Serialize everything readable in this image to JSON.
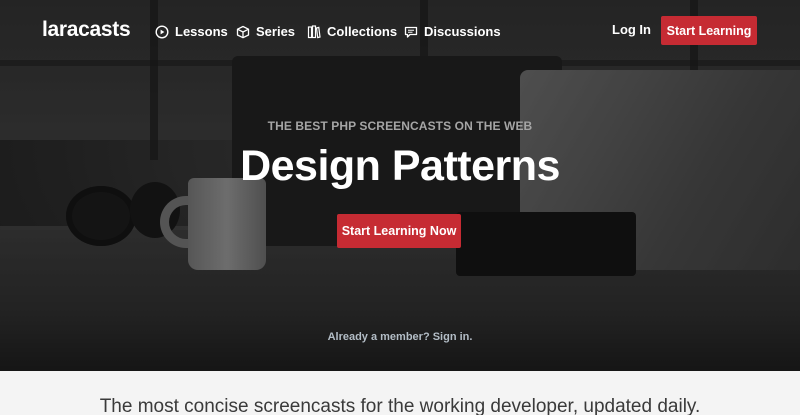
{
  "nav": {
    "logo": "laracasts",
    "items": [
      {
        "label": "Lessons",
        "icon": "play-circle-icon"
      },
      {
        "label": "Series",
        "icon": "cube-icon"
      },
      {
        "label": "Collections",
        "icon": "books-icon"
      },
      {
        "label": "Discussions",
        "icon": "chat-icon"
      }
    ],
    "login_label": "Log In",
    "cta_label": "Start Learning"
  },
  "hero": {
    "kicker": "THE BEST PHP SCREENCASTS ON THE WEB",
    "headline": "Design Patterns",
    "cta_label": "Start Learning Now",
    "member_text": "Already a member? Sign in."
  },
  "content": {
    "tagline": "The most concise screencasts for the working developer, updated daily."
  },
  "colors": {
    "accent": "#c62b33",
    "hero_text": "#ffffff",
    "kicker": "#a5a5a5",
    "page_bg": "#f4f4f4"
  }
}
